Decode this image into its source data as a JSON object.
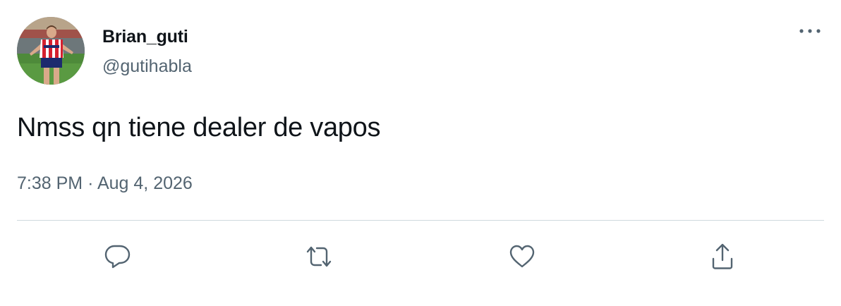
{
  "author": {
    "display_name": "Brian_guti",
    "handle": "@gutihabla"
  },
  "tweet": {
    "text": "Nmss qn tiene dealer de vapos",
    "time": "7:38 PM",
    "separator": "·",
    "date": "Aug 4, 2026"
  },
  "icons": {
    "more": "more-dots-icon",
    "reply": "speech-bubble-icon",
    "retweet": "retweet-arrows-icon",
    "like": "heart-icon",
    "share": "share-upload-icon"
  },
  "colors": {
    "text_primary": "#0f1419",
    "text_secondary": "#536471",
    "divider": "#cfd9de",
    "jersey_red": "#d5202f"
  }
}
